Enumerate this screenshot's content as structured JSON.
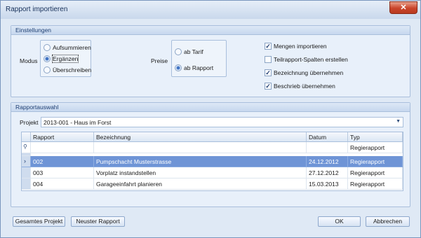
{
  "window": {
    "title": "Rapport importieren",
    "close_label": "✕"
  },
  "settings": {
    "title": "Einstellungen",
    "modus_label": "Modus",
    "modus_options": [
      "Aufsummieren",
      "Ergänzen",
      "Überschreiben"
    ],
    "preise_label": "Preise",
    "preise_options": [
      "ab Tarif",
      "ab Rapport"
    ],
    "checkboxes": [
      {
        "label": "Mengen importieren",
        "checked": true
      },
      {
        "label": "Teilrapport-Spalten erstellen",
        "checked": false
      },
      {
        "label": "Bezeichnung übernehmen",
        "checked": true
      },
      {
        "label": "Beschrieb übernehmen",
        "checked": true
      }
    ]
  },
  "selection": {
    "title": "Rapportauswahl",
    "projekt_label": "Projekt",
    "projekt_value": "2013-001 - Haus im Forst",
    "columns": [
      "Rapport",
      "Bezeichnung",
      "Datum",
      "Typ"
    ],
    "filter_typ": "Regierapport",
    "rows": [
      {
        "rapport": "002",
        "bezeichnung": "Pumpschacht Musterstrasse",
        "datum": "24.12.2012",
        "typ": "Regierapport"
      },
      {
        "rapport": "003",
        "bezeichnung": "Vorplatz instandstellen",
        "datum": "27.12.2012",
        "typ": "Regierapport"
      },
      {
        "rapport": "004",
        "bezeichnung": "Garageeinfahrt planieren",
        "datum": "15.03.2013",
        "typ": "Regierapport"
      }
    ]
  },
  "buttons": {
    "gesamtes_projekt": "Gesamtes Projekt",
    "neuster_rapport": "Neuster Rapport",
    "ok": "OK",
    "abbrechen": "Abbrechen"
  }
}
